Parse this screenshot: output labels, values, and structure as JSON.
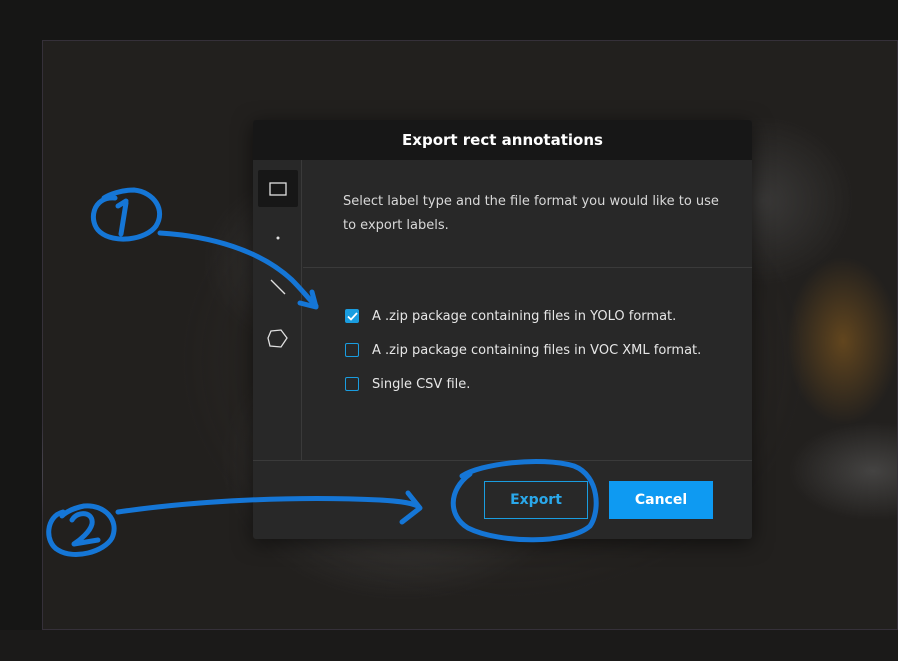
{
  "dialog": {
    "title": "Export rect annotations",
    "description": "Select label type and the file format you would like to use to export labels.",
    "label_types": [
      {
        "icon": "rectangle-icon",
        "active": true
      },
      {
        "icon": "point-icon",
        "active": false
      },
      {
        "icon": "line-icon",
        "active": false
      },
      {
        "icon": "polygon-icon",
        "active": false
      }
    ],
    "options": [
      {
        "label": "A .zip package containing files in YOLO format.",
        "checked": true
      },
      {
        "label": "A .zip package containing files in VOC XML format.",
        "checked": false
      },
      {
        "label": "Single CSV file.",
        "checked": false
      }
    ],
    "buttons": {
      "export_label": "Export",
      "cancel_label": "Cancel"
    }
  },
  "colors": {
    "accent": "#1a9de0",
    "cancel_bg": "#0e9af2",
    "dialog_bg": "#282828",
    "header_bg": "#171717",
    "annotation_ink": "#1576d6"
  }
}
